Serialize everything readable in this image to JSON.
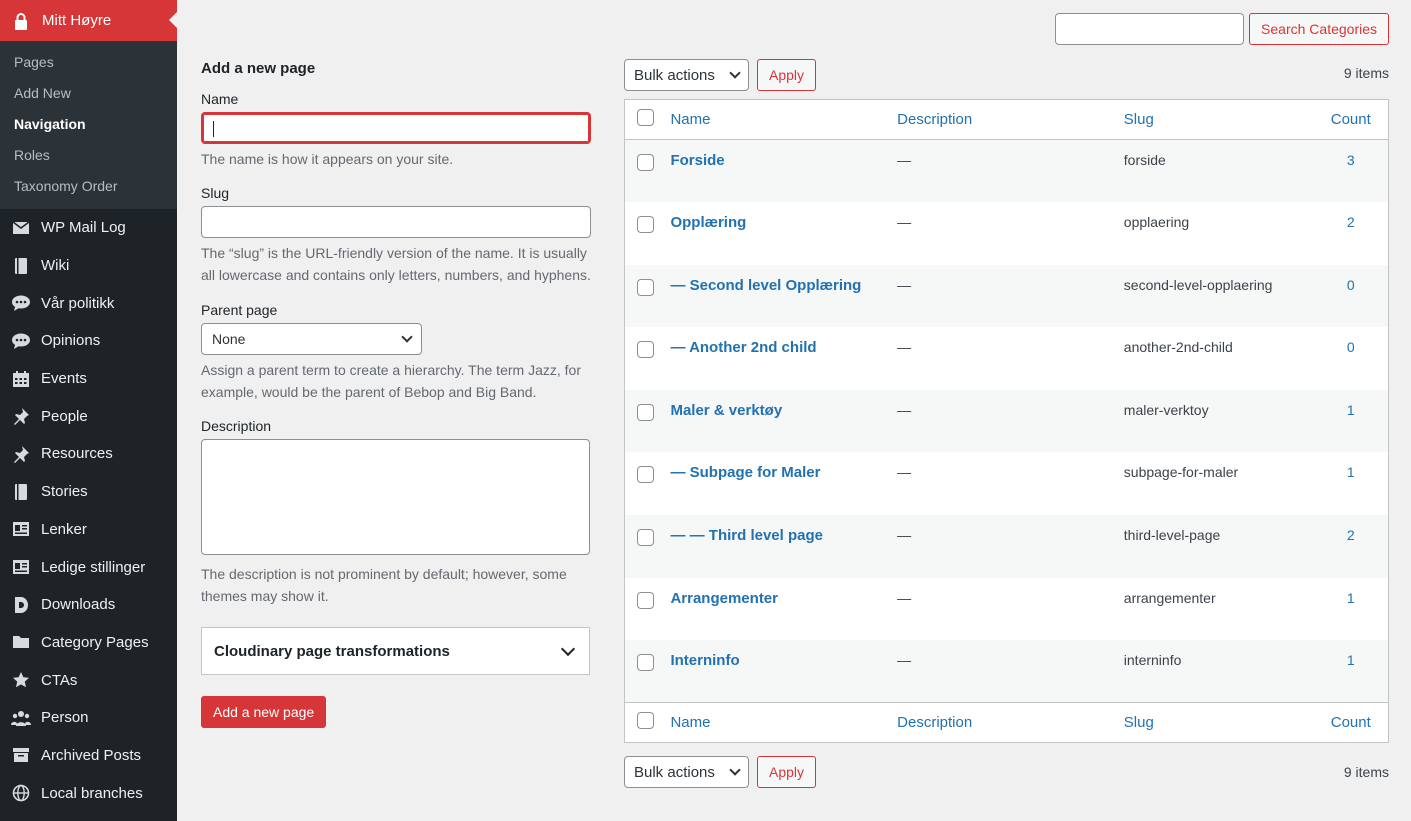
{
  "sidebar": {
    "active": {
      "label": "Mitt Høyre",
      "icon": "lock-icon"
    },
    "submenu": [
      {
        "label": "Pages"
      },
      {
        "label": "Add New"
      },
      {
        "label": "Navigation"
      },
      {
        "label": "Roles"
      },
      {
        "label": "Taxonomy Order"
      }
    ],
    "items": [
      {
        "label": "WP Mail Log",
        "icon": "envelope-icon"
      },
      {
        "label": "Wiki",
        "icon": "book-icon"
      },
      {
        "label": "Vår politikk",
        "icon": "comments-icon"
      },
      {
        "label": "Opinions",
        "icon": "comments-icon"
      },
      {
        "label": "Events",
        "icon": "calendar-icon"
      },
      {
        "label": "People",
        "icon": "pin-icon"
      },
      {
        "label": "Resources",
        "icon": "pin-icon"
      },
      {
        "label": "Stories",
        "icon": "book-icon"
      },
      {
        "label": "Lenker",
        "icon": "id-card-icon"
      },
      {
        "label": "Ledige stillinger",
        "icon": "id-card-icon"
      },
      {
        "label": "Downloads",
        "icon": "downloads-logo-icon"
      },
      {
        "label": "Category Pages",
        "icon": "folder-icon"
      },
      {
        "label": "CTAs",
        "icon": "star-icon"
      },
      {
        "label": "Person",
        "icon": "groups-icon"
      },
      {
        "label": "Archived Posts",
        "icon": "archive-icon"
      },
      {
        "label": "Local branches",
        "icon": "globe-icon"
      }
    ]
  },
  "search": {
    "value": "",
    "button_label": "Search Categories"
  },
  "form": {
    "title": "Add a new page",
    "name_label": "Name",
    "name_value": "",
    "name_help": "The name is how it appears on your site.",
    "slug_label": "Slug",
    "slug_value": "",
    "slug_help": "The “slug” is the URL-friendly version of the name. It is usually all lowercase and contains only letters, numbers, and hyphens.",
    "parent_label": "Parent page",
    "parent_value": "None",
    "parent_help": "Assign a parent term to create a hierarchy. The term Jazz, for example, would be the parent of Bebop and Big Band.",
    "description_label": "Description",
    "description_value": "",
    "description_help": "The description is not prominent by default; however, some themes may show it.",
    "accordion_label": "Cloudinary page transformations",
    "submit_label": "Add a new page"
  },
  "list": {
    "bulk_label": "Bulk actions",
    "apply_label": "Apply",
    "items_count": "9 items",
    "columns": {
      "name": "Name",
      "description": "Description",
      "slug": "Slug",
      "count": "Count"
    },
    "rows": [
      {
        "name": "Forside",
        "description": "—",
        "slug": "forside",
        "count": "3"
      },
      {
        "name": "Opplæring",
        "description": "—",
        "slug": "opplaering",
        "count": "2"
      },
      {
        "name": "— Second level Opplæring",
        "description": "—",
        "slug": "second-level-opplaering",
        "count": "0"
      },
      {
        "name": "— Another 2nd child",
        "description": "—",
        "slug": "another-2nd-child",
        "count": "0"
      },
      {
        "name": "Maler & verktøy",
        "description": "—",
        "slug": "maler-verktoy",
        "count": "1"
      },
      {
        "name": "— Subpage for Maler",
        "description": "—",
        "slug": "subpage-for-maler",
        "count": "1"
      },
      {
        "name": "— — Third level page",
        "description": "—",
        "slug": "third-level-page",
        "count": "2"
      },
      {
        "name": "Arrangementer",
        "description": "—",
        "slug": "arrangementer",
        "count": "1"
      },
      {
        "name": "Interninfo",
        "description": "—",
        "slug": "interninfo",
        "count": "1"
      }
    ]
  },
  "colors": {
    "accent": "#d63638",
    "link": "#2271b1",
    "sidebar_bg": "#1d2327"
  }
}
